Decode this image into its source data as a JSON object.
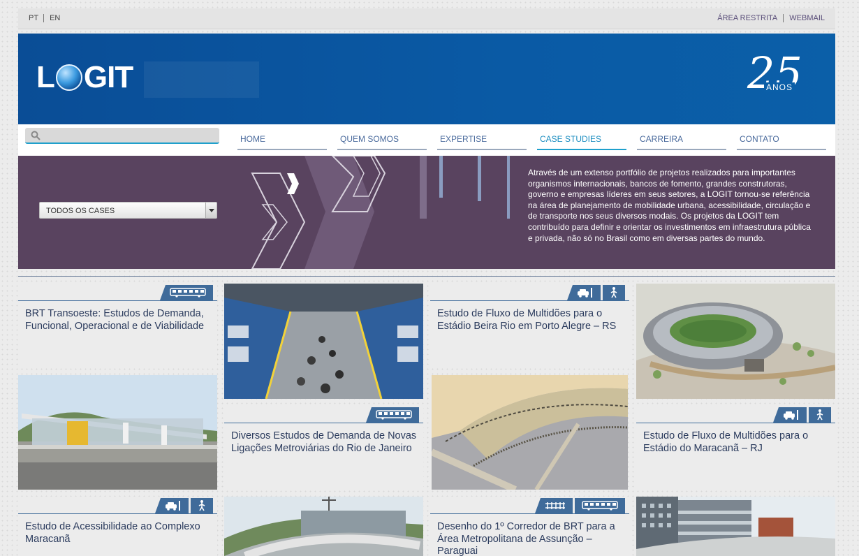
{
  "topbar": {
    "lang_pt": "PT",
    "lang_en": "EN",
    "restricted": "ÁREA RESTRITA",
    "webmail": "WEBMAIL"
  },
  "header": {
    "logo_text_l": "L",
    "logo_text_rest": "GIT",
    "anniversary_number": "25",
    "anniversary_text": "ANOS"
  },
  "search": {
    "placeholder": "",
    "icon": "search-icon"
  },
  "nav": {
    "items": [
      "HOME",
      "QUEM SOMOS",
      "EXPERTISE",
      "CASE STUDIES",
      "CARREIRA",
      "CONTATO"
    ],
    "active": "CASE STUDIES"
  },
  "filter": {
    "selected": "TODOS OS CASES"
  },
  "intro_text": "Através de um extenso portfólio de projetos realizados para importantes organismos internacionais, bancos de fomento, grandes construtoras, governo e empresas líderes em seus setores, a LOGIT tornou-se referência na área de planejamento de mobilidade urbana, acessibilidade, circulação e de transporte nos seus diversos modais. Os projetos da LOGIT tem contribuído para definir e orientar os investimentos em infraestrutura pública e privada, não só no Brasil como em diversas partes do mundo.",
  "cards": [
    {
      "title": "BRT Transoeste: Estudos de Demanda, Funcional, Operacional e de Viabilidade",
      "icons": [
        "bus-icon"
      ]
    },
    {
      "title": "Estudo de Fluxo de Multidões para o Estádio Beira Rio em Porto Alegre – RS",
      "icons": [
        "car-icon",
        "pedestrian-icon"
      ]
    },
    {
      "title": "Diversos Estudos de Demanda de Novas Ligações Metroviárias do Rio de Janeiro",
      "icons": [
        "bus-icon"
      ]
    },
    {
      "title": "Estudo de Fluxo de Multidões para o Estádio do Maracanã – RJ",
      "icons": [
        "car-icon",
        "pedestrian-icon"
      ]
    },
    {
      "title": "Estudo de Acessibilidade ao Complexo Maracanã",
      "icons": [
        "car-icon",
        "pedestrian-icon"
      ]
    },
    {
      "title": "Desenho do 1º Corredor de BRT para a Área Metropolitana de Assunção – Paraguai",
      "icons": [
        "rail-icon",
        "bus-icon"
      ]
    }
  ],
  "colors": {
    "header_blue": "#0a5aa5",
    "band_purple": "#59435f",
    "tab_blue": "#3f6b9a",
    "active_nav": "#1fa0cc"
  }
}
